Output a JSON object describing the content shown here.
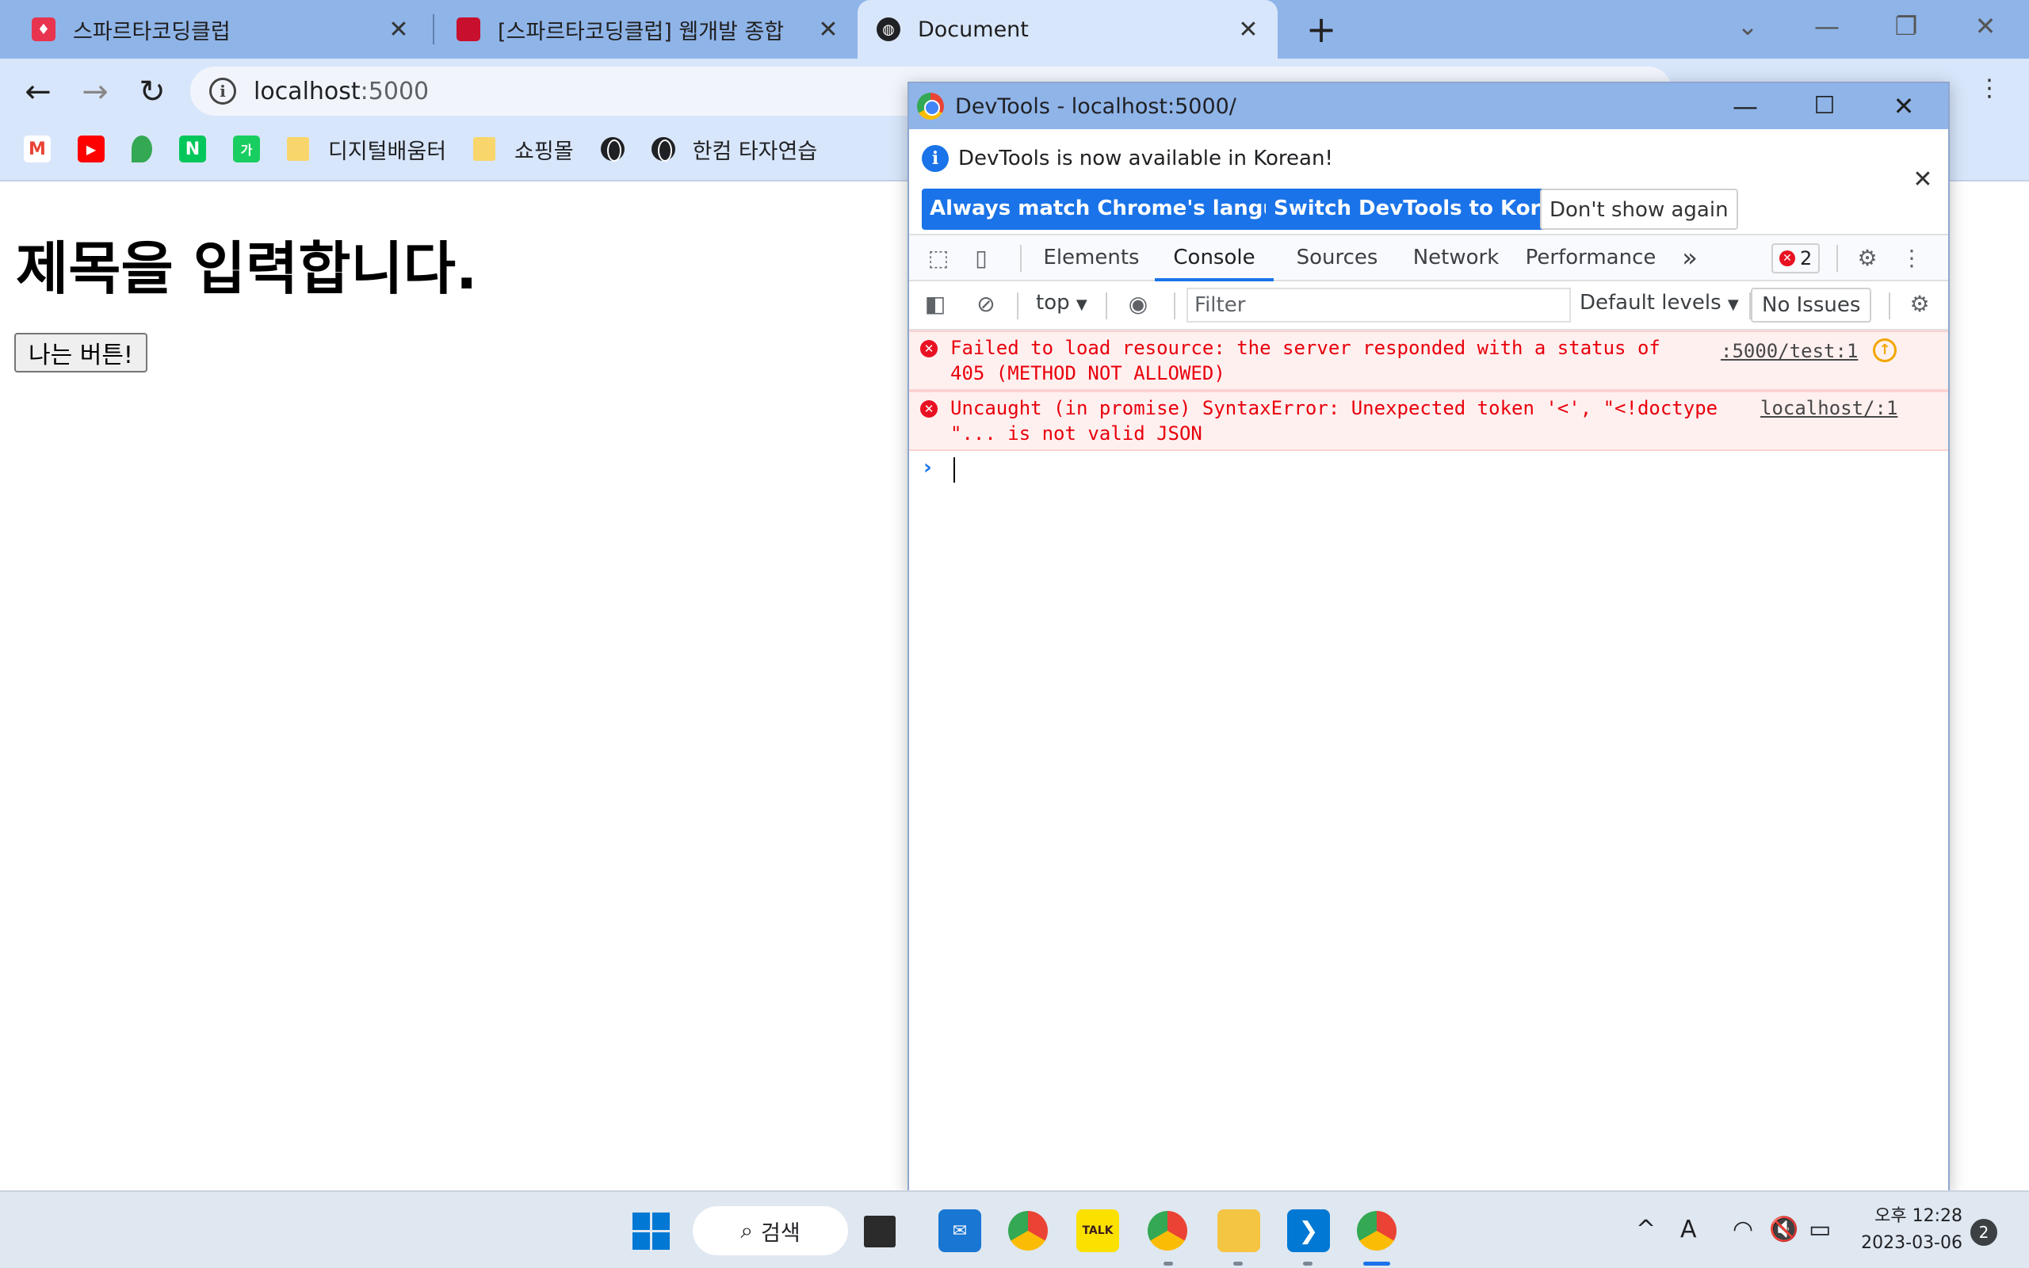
{
  "browser": {
    "tabs": [
      {
        "title": "스파르타코딩클럽",
        "icon": "sparta-icon"
      },
      {
        "title": "[스파르타코딩클럽] 웹개발 종합",
        "icon": "book-icon"
      },
      {
        "title": "Document",
        "icon": "globe-icon"
      }
    ],
    "new_tab": "+",
    "url_host": "localhost",
    "url_port": ":5000",
    "bookmarks": [
      {
        "label": "",
        "icon": "gmail-icon"
      },
      {
        "label": "",
        "icon": "youtube-icon"
      },
      {
        "label": "",
        "icon": "maps-icon"
      },
      {
        "label": "",
        "icon": "naver-icon"
      },
      {
        "label": "",
        "icon": "ga-icon"
      },
      {
        "label": "디지털배움터",
        "icon": "folder-icon"
      },
      {
        "label": "쇼핑몰",
        "icon": "folder-icon"
      },
      {
        "label": "",
        "icon": "globe-icon"
      },
      {
        "label": "한컴 타자연습",
        "icon": "globe-icon"
      }
    ],
    "colors": {
      "tabstrip": "#8fb4e8",
      "toolbar": "#d8e6fb"
    }
  },
  "page": {
    "heading": "제목을 입력합니다.",
    "button_label": "나는 버튼!"
  },
  "devtools": {
    "window_title": "DevTools - localhost:5000/",
    "infobar": {
      "message": "DevTools is now available in Korean!",
      "btn_match": "Always match Chrome's language",
      "btn_switch": "Switch DevTools to Korean",
      "btn_dismiss": "Don't show again"
    },
    "tabs": [
      "Elements",
      "Console",
      "Sources",
      "Network",
      "Performance"
    ],
    "active_tab": "Console",
    "more_tabs": "»",
    "error_count": "2",
    "console_bar": {
      "context": "top",
      "filter_placeholder": "Filter",
      "levels": "Default levels",
      "issues": "No Issues"
    },
    "messages": [
      {
        "level": "error",
        "text": "Failed to load resource: the server responded with a status of\n405 (METHOD NOT ALLOWED)",
        "source": ":5000/test:1"
      },
      {
        "level": "error",
        "text": "Uncaught (in promise) SyntaxError: Unexpected token '<', \"<!doctype\n\"... is not valid JSON",
        "source": "localhost/:1"
      }
    ],
    "prompt": "›"
  },
  "taskbar": {
    "search_label": "검색",
    "apps": [
      "windows-start",
      "task-view",
      "mail",
      "chrome",
      "kakaotalk",
      "chrome-profile",
      "file-explorer",
      "vscode",
      "chrome-active"
    ],
    "tray": {
      "chevron": "^",
      "ime": "A"
    },
    "clock_time": "오후 12:28",
    "clock_date": "2023-03-06",
    "notifications": "2"
  }
}
